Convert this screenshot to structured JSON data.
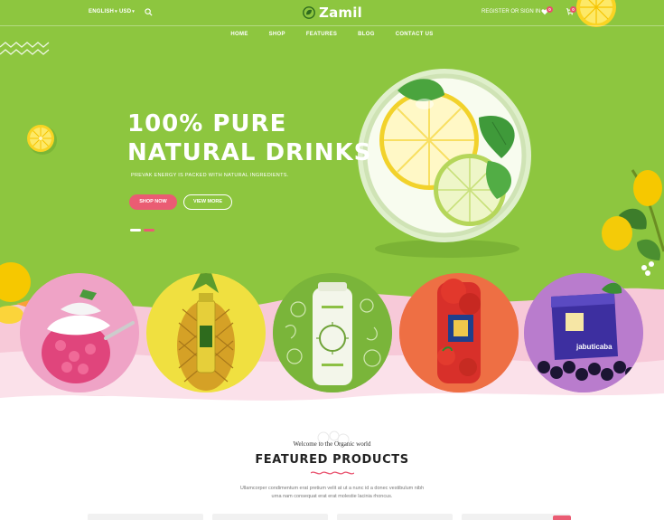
{
  "topbar": {
    "language": "ENGLISH",
    "currency": "USD",
    "register": "REGISTER OR SIGN IN",
    "wishlist_count": "0",
    "cart_count": "0"
  },
  "logo": {
    "text": "Zamil"
  },
  "nav": {
    "items": [
      "HOME",
      "SHOP",
      "FEATURES",
      "BLOG",
      "CONTACT US"
    ]
  },
  "hero": {
    "title_line1": "100% PURE",
    "title_line2": "NATURAL DRINKS",
    "subtitle": "PREVAK ENERGY IS PACKED WITH NATURAL INGREDIENTS.",
    "shop_button": "SHOP NOW",
    "more_button": "VIEW MORE"
  },
  "products_circles": {
    "icons": [
      "yogurt-raspberry-image",
      "pineapple-juice-image",
      "green-juice-bottle-image",
      "tomato-pepper-image",
      "jabuticaba-pack-image"
    ],
    "pack_label": "jabuticaba"
  },
  "featured": {
    "welcome": "Welcome to the Organic world",
    "title": "FEATURED PRODUCTS",
    "desc_line1": "Ullamcorper condimentum erat pretium velit at ut a nunc id a donec vestibulum nibh",
    "desc_line2": "urna nam consequat erat erat molestie lacinia rhoncus."
  },
  "colors": {
    "hero_green": "#8dc63f",
    "accent_pink": "#ea5c73",
    "wash_pink": "#f7c9d8"
  }
}
